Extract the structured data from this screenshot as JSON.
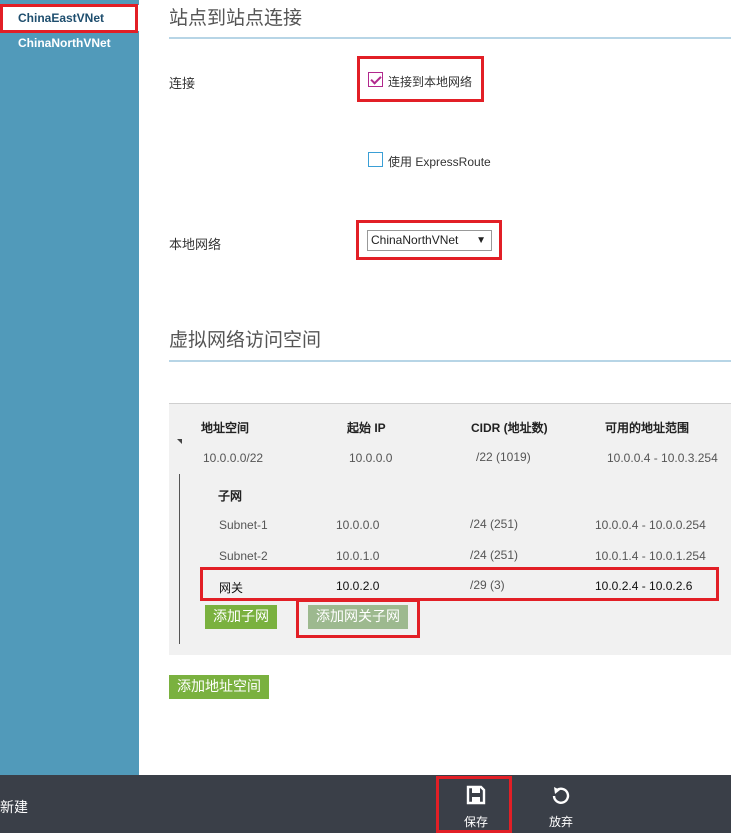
{
  "sidebar": {
    "items": [
      {
        "label": "ChinaEastVNet"
      },
      {
        "label": "ChinaNorthVNet"
      }
    ]
  },
  "s2s": {
    "title": "站点到站点连接",
    "connection_label": "连接",
    "connect_local_label": "连接到本地网络",
    "connect_local_checked": true,
    "expressroute_label": "使用 ExpressRoute",
    "expressroute_checked": false,
    "local_network_label": "本地网络",
    "local_network_value": "ChinaNorthVNet"
  },
  "vnet_space": {
    "title": "虚拟网络访问空间",
    "columns": [
      "地址空间",
      "起始 IP",
      "CIDR (地址数)",
      "可用的地址范围"
    ],
    "address_space": {
      "address": "10.0.0.0/22",
      "start_ip": "10.0.0.0",
      "cidr": "/22 (1019)",
      "range": "10.0.0.4 - 10.0.3.254"
    },
    "subnet_header": "子网",
    "subnets": [
      {
        "name": "Subnet-1",
        "start_ip": "10.0.0.0",
        "cidr": "/24 (251)",
        "range": "10.0.0.4 - 10.0.0.254"
      },
      {
        "name": "Subnet-2",
        "start_ip": "10.0.1.0",
        "cidr": "/24 (251)",
        "range": "10.0.1.4 - 10.0.1.254"
      },
      {
        "name": "网关",
        "start_ip": "10.0.2.0",
        "cidr": "/29 (3)",
        "range": "10.0.2.4 - 10.0.2.6"
      }
    ],
    "add_subnet_label": "添加子网",
    "add_gateway_subnet_label": "添加网关子网",
    "add_address_space_label": "添加地址空间"
  },
  "commandbar": {
    "new_label": "新建",
    "save_label": "保存",
    "discard_label": "放弃"
  },
  "colors": {
    "sidebar": "#519aba",
    "highlight": "#e21f26",
    "green_button": "#7ab13f",
    "commandbar": "#3a3f48"
  }
}
